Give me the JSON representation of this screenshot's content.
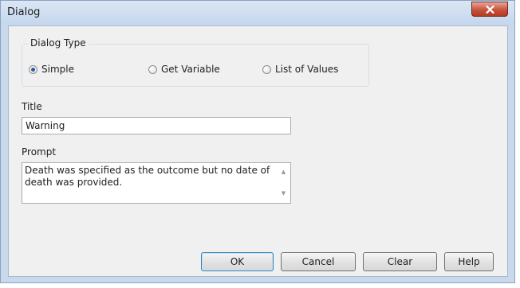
{
  "window": {
    "title": "Dialog"
  },
  "dialog_type": {
    "legend": "Dialog Type",
    "options": [
      {
        "label": "Simple",
        "checked": true
      },
      {
        "label": "Get Variable",
        "checked": false
      },
      {
        "label": "List of Values",
        "checked": false
      }
    ]
  },
  "title_field": {
    "label": "Title",
    "value": "Warning"
  },
  "prompt_field": {
    "label": "Prompt",
    "value": "Death was specified as the outcome but no date of death was provided."
  },
  "buttons": {
    "ok": "OK",
    "cancel": "Cancel",
    "clear": "Clear",
    "help": "Help"
  },
  "icons": {
    "close": "close-icon",
    "scroll_up": "scroll-up-icon",
    "scroll_down": "scroll-down-icon"
  },
  "colors": {
    "title_bar": "#c9d9ec",
    "close_button": "#c8533f",
    "radio_checked": "#2a5aa8"
  }
}
